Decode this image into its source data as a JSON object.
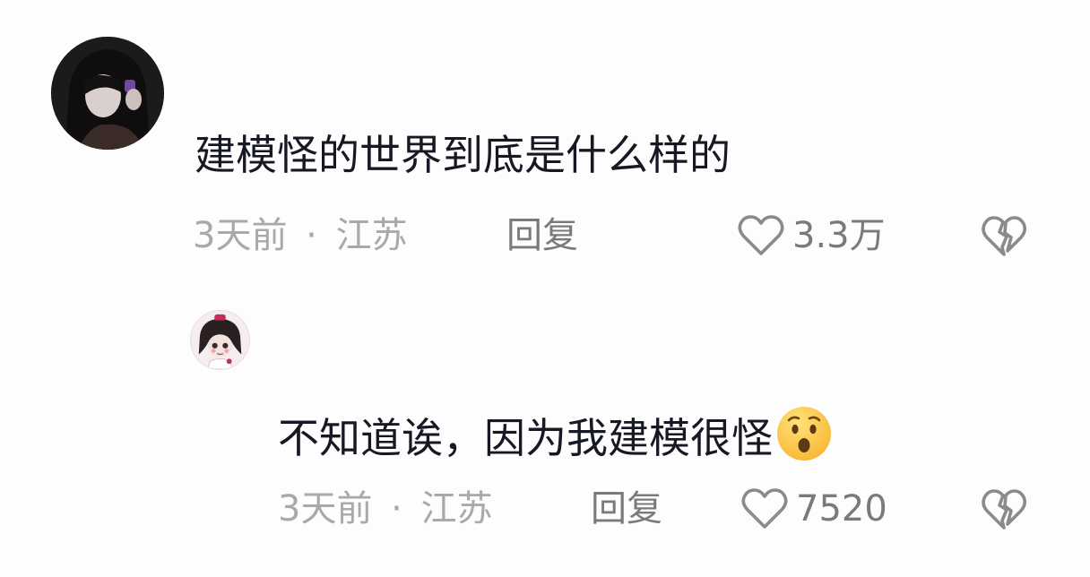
{
  "comments": [
    {
      "text": "建模怪的世界到底是什么样的",
      "time": "3天前",
      "location": "江苏",
      "reply_label": "回复",
      "likes": "3.3万"
    },
    {
      "text": "不知道诶，因为我建模很怪",
      "emoji": "hushed-face",
      "time": "3天前",
      "location": "江苏",
      "reply_label": "回复",
      "likes": "7520"
    }
  ],
  "meta_separator": "·",
  "icons": {
    "like": "heart-outline-icon",
    "dislike": "broken-heart-icon"
  },
  "colors": {
    "background": "#fdfdfd",
    "text_primary": "#161823",
    "text_secondary": "#a9a9ab",
    "text_action": "#7a7a7d",
    "icon": "#8a8a8d"
  }
}
